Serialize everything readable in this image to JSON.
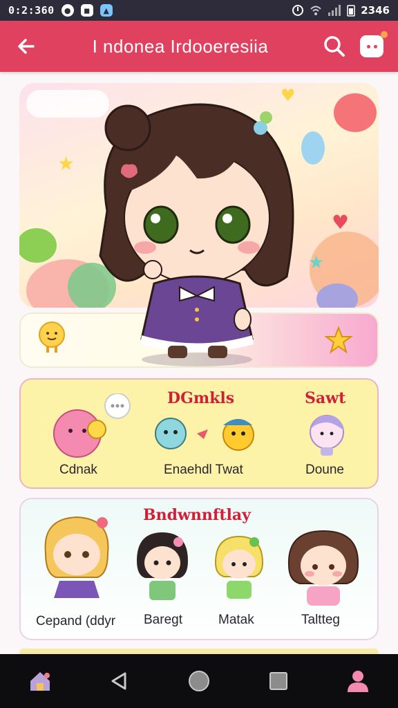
{
  "status_bar": {
    "time": "0:2:360",
    "icons": [
      "shield-icon",
      "photo-icon",
      "gallery-icon"
    ],
    "clock": "2346"
  },
  "app_bar": {
    "title": "I ndonea Irdooeresiia",
    "back_icon": "arrow-left-icon",
    "search_icon": "search-icon",
    "chat_icon": "chat-bubble-icon"
  },
  "colors": {
    "accent": "#e0415e",
    "heading_red": "#d11f37",
    "card_yellow": "#fcf3a8",
    "nav_bg": "#0d0d10"
  },
  "section_one": {
    "headings": [
      "DGmkls",
      "Sawt"
    ],
    "items": [
      {
        "label": "Cdnak",
        "icon": "pink-blob-character-icon"
      },
      {
        "label": "Enaehdl Twat",
        "icon": "blob-pair-character-icon"
      },
      {
        "label": "Doune",
        "icon": "lilac-character-icon"
      }
    ]
  },
  "section_two": {
    "heading": "Bndwnnftlay",
    "items": [
      {
        "label": "Cepand (ddyr",
        "icon": "blonde-girl-character-icon"
      },
      {
        "label": "Baregt",
        "icon": "dark-hair-girl-character-icon"
      },
      {
        "label": "Matak",
        "icon": "clover-girl-character-icon"
      },
      {
        "label": "Taltteg",
        "icon": "brown-hair-girl-character-icon"
      }
    ]
  },
  "nav": {
    "items": [
      "home-icon",
      "back-triangle-icon",
      "home-circle-icon",
      "recents-square-icon",
      "profile-icon"
    ]
  }
}
